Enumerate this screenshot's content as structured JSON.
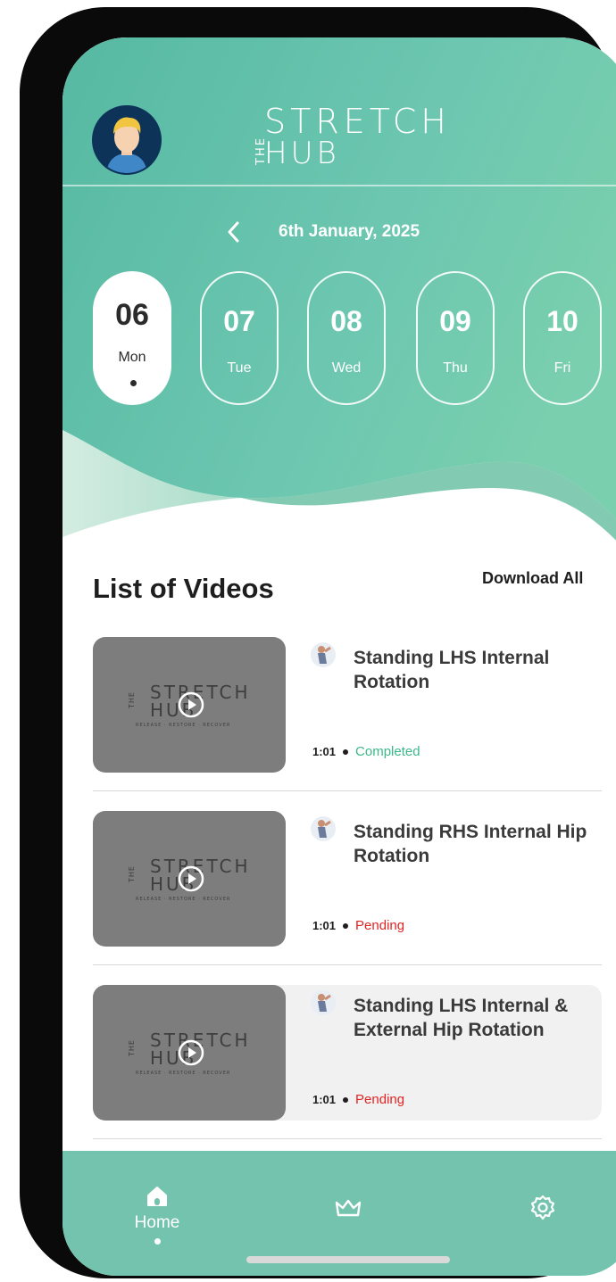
{
  "header": {
    "logo": {
      "the": "THE",
      "line1": "STRETCH",
      "line2": "HUB"
    },
    "avatar_icon": "user-avatar-icon"
  },
  "date_nav": {
    "back_icon": "chevron-left-icon",
    "label": "6th January, 2025"
  },
  "days": [
    {
      "num": "06",
      "dow": "Mon",
      "selected": true
    },
    {
      "num": "07",
      "dow": "Tue"
    },
    {
      "num": "08",
      "dow": "Wed"
    },
    {
      "num": "09",
      "dow": "Thu"
    },
    {
      "num": "10",
      "dow": "Fri"
    }
  ],
  "list": {
    "title": "List of Videos",
    "download_all": "Download All",
    "videos": [
      {
        "title": "Standing LHS Internal Rotation",
        "duration": "1:01",
        "status": "Completed"
      },
      {
        "title": "Standing RHS Internal Hip Rotation",
        "duration": "1:01",
        "status": "Pending"
      },
      {
        "title": "Standing LHS Internal & External Hip Rotation",
        "duration": "1:01",
        "status": "Pending"
      }
    ],
    "thumb_watermark": {
      "the": "THE",
      "line1": "STRETCH",
      "line2": "HUB",
      "tagline": "RELEASE · RESTORE · RECOVER"
    }
  },
  "tabbar": {
    "home_label": "Home",
    "icons": [
      "home-icon",
      "crown-icon",
      "gear-icon"
    ]
  },
  "colors": {
    "accent": "#5ebfa6",
    "accent_light": "#7dd0b5",
    "completed": "#3cb88b",
    "pending": "#e02424",
    "tabbar": "#74c3ae"
  }
}
